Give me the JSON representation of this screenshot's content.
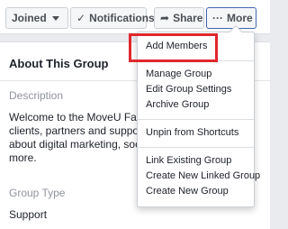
{
  "actions": {
    "joined_label": "Joined",
    "notifications_label": "Notifications",
    "share_label": "Share",
    "more_label": "More",
    "more_icon": "···"
  },
  "about": {
    "title": "About This Group",
    "description_label": "Description",
    "description_text": "Welcome to the MoveU Faclac\nclients, partners and suppor p\nabout digital marketing, soc\nmore.",
    "group_type_label": "Group Type",
    "group_type_value": "Support"
  },
  "menu": {
    "items": [
      "Add Members",
      "Manage Group",
      "Edit Group Settings",
      "Archive Group",
      "Unpin from Shortcuts",
      "Link Existing Group",
      "Create New Linked Group",
      "Create New Group"
    ],
    "highlighted_item": "Add Members"
  },
  "colors": {
    "highlight": "#e0272d",
    "accent": "#4267b2"
  },
  "icons": {
    "joined": "chevron-down-icon",
    "notifications": "check-icon",
    "share": "share-arrow-icon",
    "more": "ellipsis-icon"
  }
}
